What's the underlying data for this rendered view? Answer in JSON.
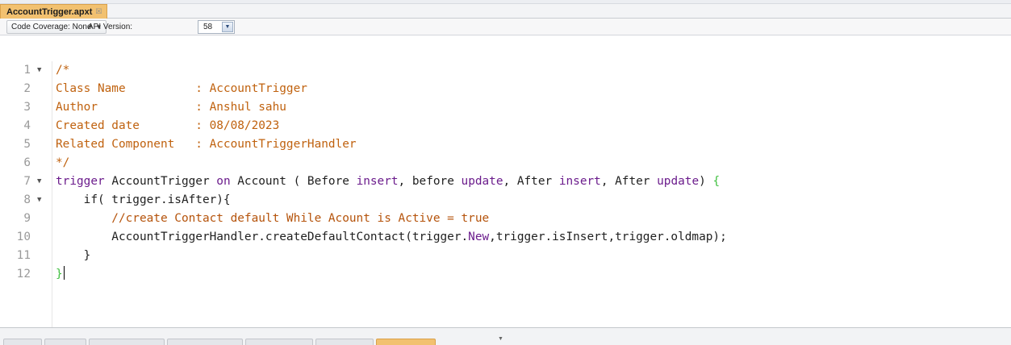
{
  "editor_tab": {
    "title": "AccountTrigger.apxt",
    "close_icon": "close-icon"
  },
  "toolbar": {
    "code_coverage_label": "Code Coverage: None",
    "api_version_label": "API Version:",
    "api_version_value": "58"
  },
  "code": {
    "line_numbers": [
      "1",
      "2",
      "3",
      "4",
      "5",
      "6",
      "7",
      "8",
      "9",
      "10",
      "11",
      "12"
    ],
    "lines": [
      "/*",
      "Class Name          : AccountTrigger",
      "Author              : Anshul sahu",
      "Created date        : 08/08/2023",
      "Related Component   : AccountTriggerHandler",
      "*/",
      "trigger AccountTrigger on Account ( Before insert, before update, After insert, After update) {",
      "    if( trigger.isAfter){",
      "        //create Contact default While Acount is Active = true",
      "        AccountTriggerHandler.createDefaultContact(trigger.New,trigger.isInsert,trigger.oldmap);",
      "    }",
      "}"
    ]
  },
  "colors": {
    "comment": "#c0620f",
    "keyword": "#6b1c8c",
    "brace": "#3fbf3f",
    "active_tab": "#f2c170"
  }
}
